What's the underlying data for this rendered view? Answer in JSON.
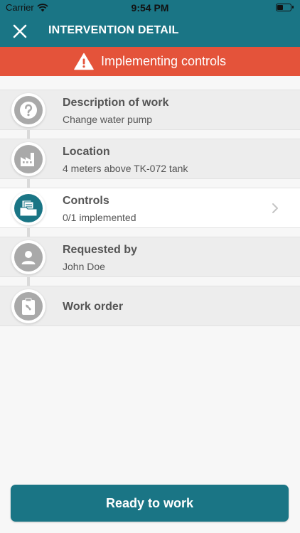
{
  "status_bar": {
    "carrier": "Carrier",
    "time": "9:54 PM",
    "icons": [
      "wifi-icon",
      "battery-icon"
    ]
  },
  "header": {
    "title": "INTERVENTION DETAIL",
    "close_icon": "close-icon"
  },
  "banner": {
    "text": "Implementing controls",
    "icon": "warning-icon",
    "color": "#e4533a"
  },
  "colors": {
    "brand": "#1a7585",
    "inactive_icon": "#a9a9a9"
  },
  "items": [
    {
      "title": "Description of work",
      "subtitle": "Change water pump",
      "icon": "question-icon"
    },
    {
      "title": "Location",
      "subtitle": "4 meters above TK-072 tank",
      "icon": "factory-icon"
    },
    {
      "title": "Controls",
      "subtitle": "0/1 implemented",
      "icon": "documents-folder-icon",
      "active": true
    },
    {
      "title": "Requested by",
      "subtitle": "John Doe",
      "icon": "person-icon"
    },
    {
      "title": "Work order",
      "subtitle": "",
      "icon": "clipboard-wrench-icon"
    }
  ],
  "footer": {
    "button_label": "Ready to work"
  }
}
